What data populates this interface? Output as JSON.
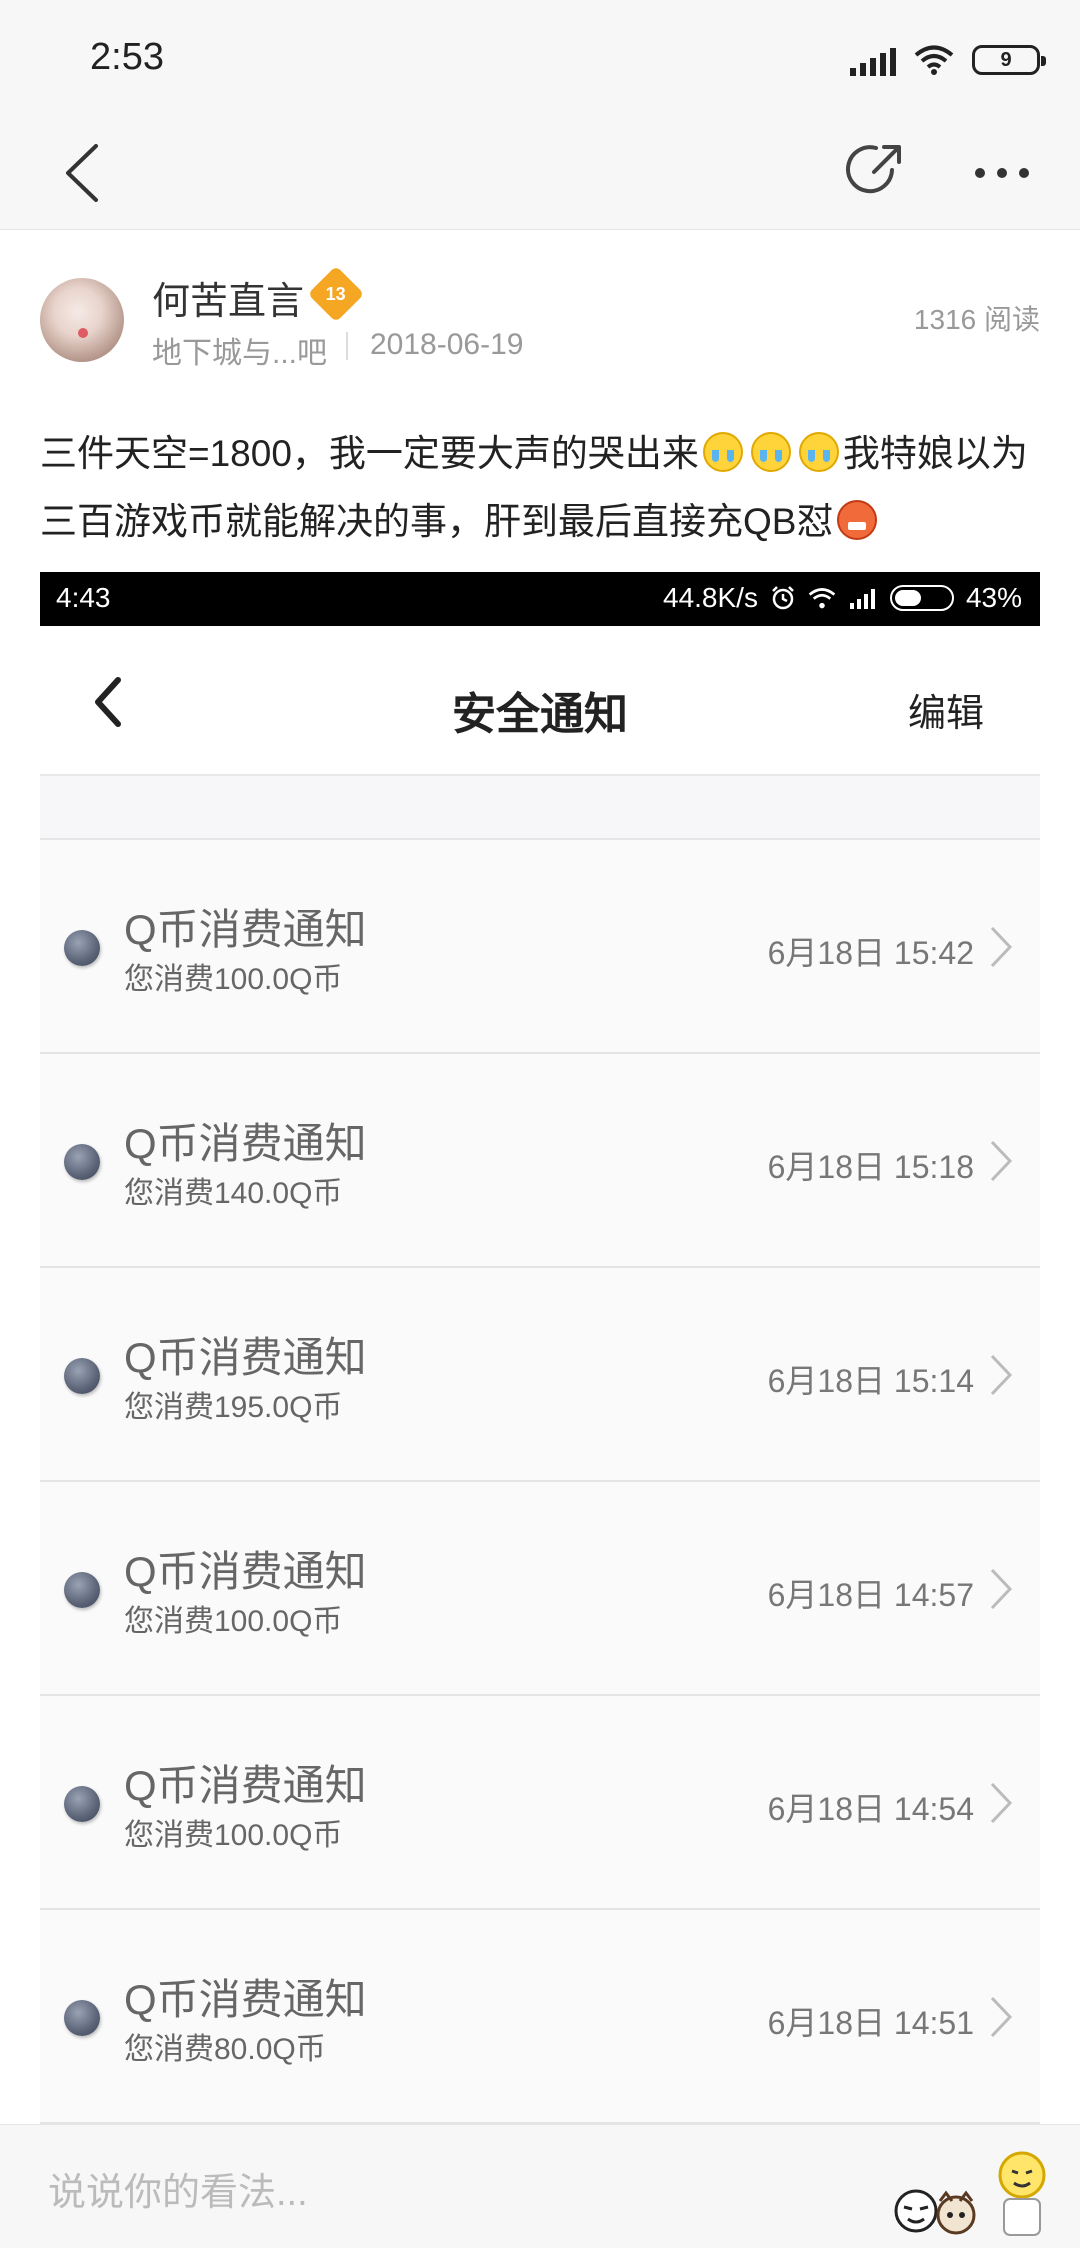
{
  "status_bar": {
    "time": "2:53",
    "battery": "9"
  },
  "nav": {
    "back_icon": "chevron-left-icon",
    "share_icon": "share-icon",
    "more_icon": "more-dots-icon"
  },
  "author": {
    "name": "何苦直言",
    "level": "13",
    "forum": "地下城与...吧",
    "date": "2018-06-19",
    "reads": "1316 阅读"
  },
  "post": {
    "text_part1": "三件天空=1800，我一定要大声的哭出来",
    "text_part2": "我特娘以为三百游戏币就能解决的事，肝到最后直接充QB怼"
  },
  "embedded": {
    "status": {
      "time": "4:43",
      "speed": "44.8K/s",
      "battery": "43%"
    },
    "title": "安全通知",
    "edit": "编辑",
    "notices": [
      {
        "title": "Q币消费通知",
        "sub": "您消费100.0Q币",
        "time": "6月18日 15:42"
      },
      {
        "title": "Q币消费通知",
        "sub": "您消费140.0Q币",
        "time": "6月18日 15:18"
      },
      {
        "title": "Q币消费通知",
        "sub": "您消费195.0Q币",
        "time": "6月18日 15:14"
      },
      {
        "title": "Q币消费通知",
        "sub": "您消费100.0Q币",
        "time": "6月18日 14:57"
      },
      {
        "title": "Q币消费通知",
        "sub": "您消费100.0Q币",
        "time": "6月18日 14:54"
      },
      {
        "title": "Q币消费通知",
        "sub": "您消费80.0Q币",
        "time": "6月18日 14:51"
      }
    ]
  },
  "comment": {
    "placeholder": "说说你的看法..."
  },
  "colors": {
    "badge": "#f5a623",
    "bar_bg": "#f7f7f7",
    "dot": "#5b6477"
  }
}
